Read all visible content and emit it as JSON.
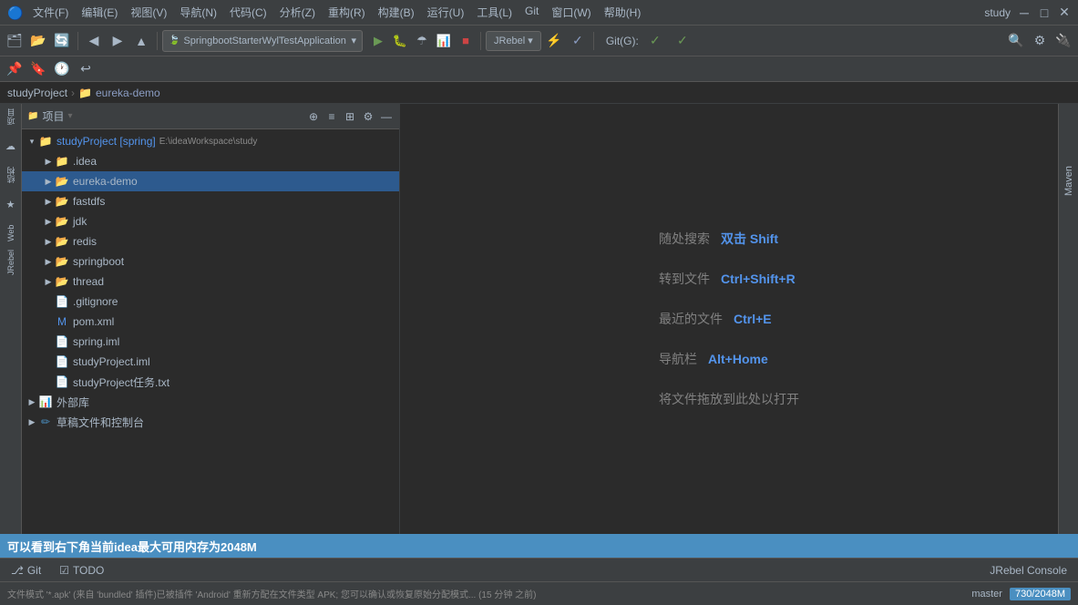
{
  "app": {
    "title": "study",
    "logo": "🔵"
  },
  "menu": {
    "items": [
      {
        "label": "文件(F)"
      },
      {
        "label": "编辑(E)"
      },
      {
        "label": "视图(V)"
      },
      {
        "label": "导航(N)"
      },
      {
        "label": "代码(C)"
      },
      {
        "label": "分析(Z)"
      },
      {
        "label": "重构(R)"
      },
      {
        "label": "构建(B)"
      },
      {
        "label": "运行(U)"
      },
      {
        "label": "工具(L)"
      },
      {
        "label": "Git"
      },
      {
        "label": "窗口(W)"
      },
      {
        "label": "帮助(H)"
      }
    ]
  },
  "toolbar": {
    "dropdown_label": "SpringbootStarterWylTestApplication",
    "jrebel_label": "JRebel ▾",
    "git_label": "Git(G):",
    "search_label": "🔍",
    "settings_label": "⚙",
    "plugins_label": "🔌"
  },
  "breadcrumb": {
    "project": "studyProject",
    "separator": "›",
    "module": "eureka-demo"
  },
  "tree": {
    "header_title": "项目",
    "root": {
      "label": "studyProject [spring]",
      "path": "E:\\ideaWorkspace\\study",
      "children": [
        {
          "label": ".idea",
          "type": "folder",
          "depth": 1
        },
        {
          "label": "eureka-demo",
          "type": "folder",
          "depth": 1,
          "selected": true
        },
        {
          "label": "fastdfs",
          "type": "folder",
          "depth": 1
        },
        {
          "label": "jdk",
          "type": "folder",
          "depth": 1
        },
        {
          "label": "redis",
          "type": "folder",
          "depth": 1
        },
        {
          "label": "springboot",
          "type": "folder",
          "depth": 1
        },
        {
          "label": "thread",
          "type": "folder",
          "depth": 1
        },
        {
          "label": ".gitignore",
          "type": "file-git",
          "depth": 1
        },
        {
          "label": "pom.xml",
          "type": "file-xml",
          "depth": 1
        },
        {
          "label": "spring.iml",
          "type": "file-iml",
          "depth": 1
        },
        {
          "label": "studyProject.iml",
          "type": "file-iml",
          "depth": 1
        },
        {
          "label": "studyProject任务.txt",
          "type": "file-txt",
          "depth": 1
        },
        {
          "label": "外部库",
          "type": "folder-lib",
          "depth": 0
        },
        {
          "label": "草稿文件和控制台",
          "type": "folder-scratch",
          "depth": 0
        }
      ]
    }
  },
  "editor": {
    "hints": [
      {
        "text": "随处搜索",
        "shortcut": "双击 Shift"
      },
      {
        "text": "转到文件",
        "shortcut": "Ctrl+Shift+R"
      },
      {
        "text": "最近的文件",
        "shortcut": "Ctrl+E"
      },
      {
        "text": "导航栏",
        "shortcut": "Alt+Home"
      },
      {
        "text": "将文件拖放到此处以打开",
        "shortcut": ""
      }
    ]
  },
  "right_panel": {
    "tabs": [
      "Maven"
    ]
  },
  "bottom_tabs": [
    {
      "icon": "⎇",
      "label": "Git"
    },
    {
      "icon": "☑",
      "label": "TODO"
    }
  ],
  "notification": {
    "text": "可以看到右下角当前idea最大可用内存为2048M"
  },
  "status_bar": {
    "left_text": "文件模式 '*.apk' (来自 'bundled' 插件)已被插件 'Android' 重新方配在文件类型 APK; 您可以确认或恢复原始分配模式... (15 分钟 之前)",
    "branch": "master",
    "memory": "730/2048M",
    "jrebel_console": "JRebel Console"
  }
}
